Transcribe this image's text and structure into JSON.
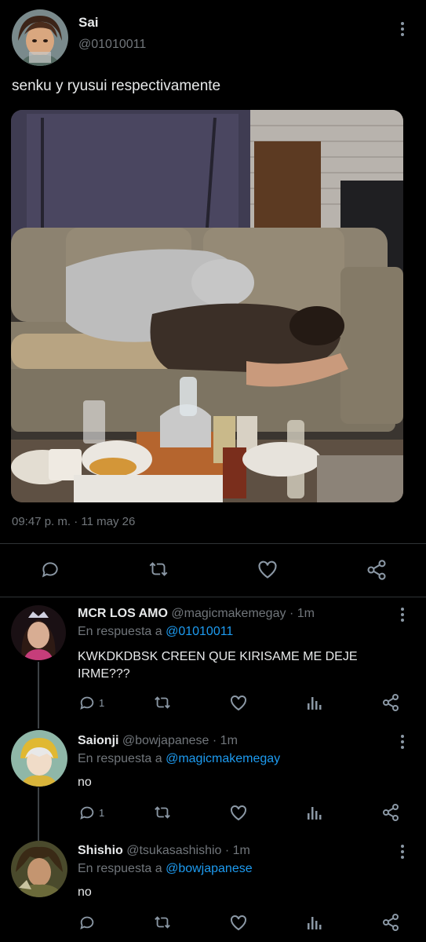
{
  "main_tweet": {
    "display_name": "Sai",
    "handle": "@01010011",
    "text": "senku y ryusui respectivamente",
    "timestamp": "09:47 p. m. · 11 may 26"
  },
  "replies": [
    {
      "display_name": "MCR LOS AMO",
      "handle": "@magicmakemegay",
      "time": "· 1m",
      "reply_prefix": "En respuesta a",
      "reply_to": "@01010011",
      "text": "KWKDKDBSK CREEN QUE KIRISAME ME DEJE IRME???",
      "reply_count": "1"
    },
    {
      "display_name": "Saionji",
      "handle": "@bowjapanese",
      "time": "· 1m",
      "reply_prefix": "En respuesta a",
      "reply_to": "@magicmakemegay",
      "text": "no",
      "reply_count": "1"
    },
    {
      "display_name": "Shishio",
      "handle": "@tsukasashishio",
      "time": "· 1m",
      "reply_prefix": "En respuesta a",
      "reply_to": "@bowjapanese",
      "text": "no",
      "reply_count": ""
    }
  ],
  "colors": {
    "background": "#000000",
    "text": "#e7e9ea",
    "secondary": "#71767b",
    "link": "#1d9bf0",
    "icon": "#8b98a5"
  },
  "icons": [
    "more-icon",
    "reply-icon",
    "retweet-icon",
    "like-icon",
    "share-icon",
    "views-icon"
  ]
}
